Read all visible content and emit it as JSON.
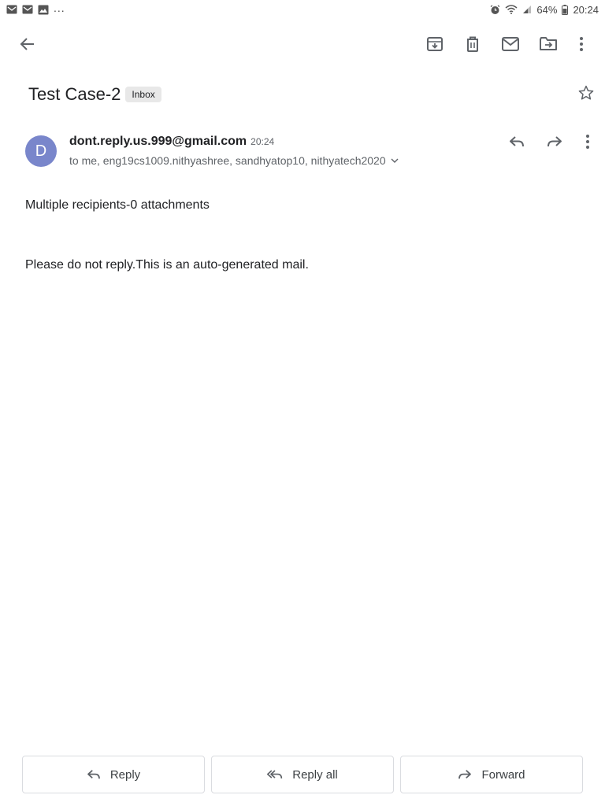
{
  "status_bar": {
    "left_icons": [
      "gmail-notification-icon",
      "gmail-notification-icon",
      "gallery-notification-icon"
    ],
    "more": "...",
    "battery": "64%",
    "time": "20:24"
  },
  "toolbar": {
    "icons": [
      "back-arrow-icon",
      "archive-icon",
      "delete-icon",
      "mark-unread-icon",
      "move-to-icon",
      "more-vert-icon"
    ]
  },
  "message": {
    "subject": "Test Case-2",
    "label": "Inbox",
    "sender_initial": "D",
    "sender_email": "dont.reply.us.999@gmail.com",
    "time": "20:24",
    "recipients": "to me, eng19cs1009.nithyashree, sandhyatop10, nithyatech2020",
    "body_line_1": "Multiple recipients-0 attachments",
    "body_line_2": "Please do not reply.This is an auto-generated mail."
  },
  "actions": {
    "reply": "Reply",
    "reply_all": "Reply all",
    "forward": "Forward"
  },
  "colors": {
    "avatar_bg": "#7986cb",
    "icon_gray": "#5f6368",
    "text_dark": "#202124"
  }
}
